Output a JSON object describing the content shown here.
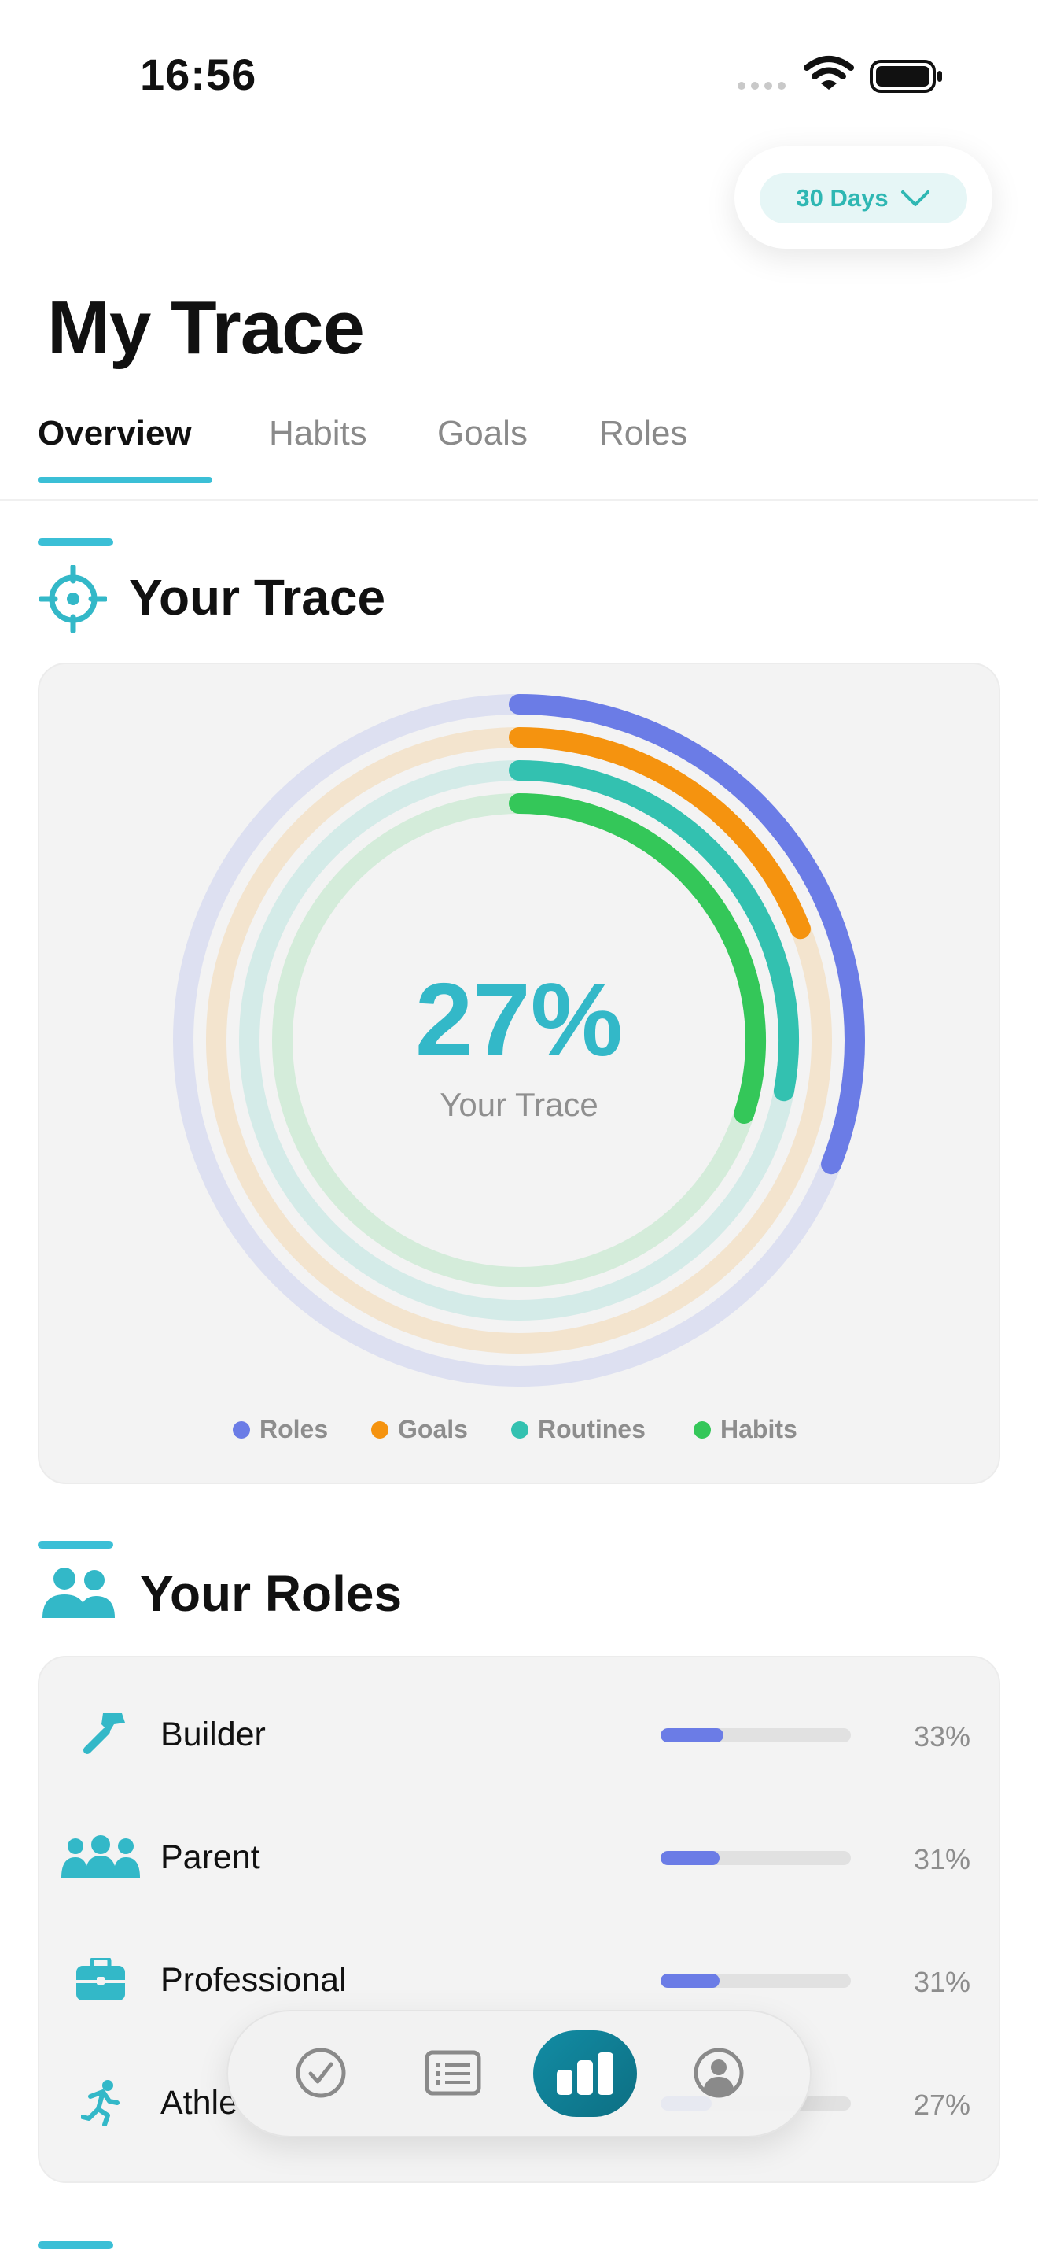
{
  "status_bar": {
    "time": "16:56"
  },
  "period": {
    "label": "30 Days"
  },
  "page": {
    "title": "My Trace"
  },
  "tabs": [
    {
      "label": "Overview",
      "active": true
    },
    {
      "label": "Habits",
      "active": false
    },
    {
      "label": "Goals",
      "active": false
    },
    {
      "label": "Roles",
      "active": false
    }
  ],
  "trace": {
    "heading": "Your Trace",
    "center_value": "27%",
    "center_label": "Your Trace",
    "rings": [
      {
        "name": "Roles",
        "color": "#6b7ce6",
        "progress": 0.31
      },
      {
        "name": "Goals",
        "color": "#f5930f",
        "progress": 0.19
      },
      {
        "name": "Routines",
        "color": "#33c1b0",
        "progress": 0.28
      },
      {
        "name": "Habits",
        "color": "#34c759",
        "progress": 0.3
      }
    ]
  },
  "roles": {
    "heading": "Your Roles",
    "items": [
      {
        "name": "Builder",
        "percent": "33%",
        "icon": "hammer-icon",
        "fill": 0.33
      },
      {
        "name": "Parent",
        "percent": "31%",
        "icon": "family-icon",
        "fill": 0.31
      },
      {
        "name": "Professional",
        "percent": "31%",
        "icon": "briefcase-icon",
        "fill": 0.31
      },
      {
        "name": "Athle",
        "percent": "27%",
        "icon": "runner-icon",
        "fill": 0.27
      }
    ]
  },
  "nav": {
    "items": [
      {
        "name": "check-icon",
        "active": false
      },
      {
        "name": "list-icon",
        "active": false
      },
      {
        "name": "stats-icon",
        "active": true
      },
      {
        "name": "profile-icon",
        "active": false
      }
    ]
  },
  "colors": {
    "accent": "#3bbfd6",
    "bar_fill": "#6b7ce6",
    "nav_active": "#128ca4"
  }
}
